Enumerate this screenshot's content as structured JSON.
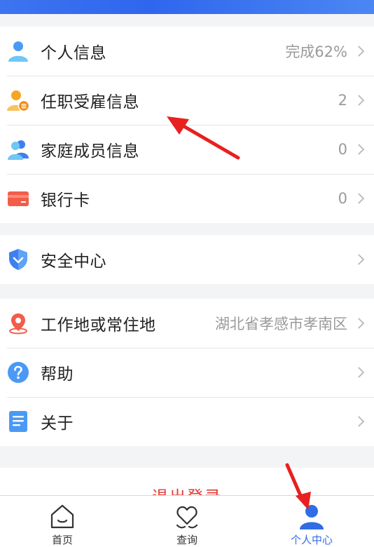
{
  "menu_group1": [
    {
      "label": "个人信息",
      "value": "完成62%",
      "icon": "person-icon"
    },
    {
      "label": "任职受雇信息",
      "value": "2",
      "icon": "employment-icon"
    },
    {
      "label": "家庭成员信息",
      "value": "0",
      "icon": "family-icon"
    },
    {
      "label": "银行卡",
      "value": "0",
      "icon": "bank-card-icon"
    }
  ],
  "menu_group2": [
    {
      "label": "安全中心",
      "icon": "shield-icon"
    }
  ],
  "menu_group3": [
    {
      "label": "工作地或常住地",
      "value": "湖北省孝感市孝南区",
      "icon": "location-icon"
    },
    {
      "label": "帮助",
      "icon": "help-icon"
    },
    {
      "label": "关于",
      "icon": "about-icon"
    }
  ],
  "logout_label": "退出登录",
  "tabbar": [
    {
      "label": "首页",
      "icon": "home-icon"
    },
    {
      "label": "查询",
      "icon": "query-icon"
    },
    {
      "label": "个人中心",
      "icon": "profile-icon",
      "active": true
    }
  ],
  "colors": {
    "accent": "#2f6de6",
    "logout": "#e53935",
    "annotation_arrow": "#e82020"
  }
}
